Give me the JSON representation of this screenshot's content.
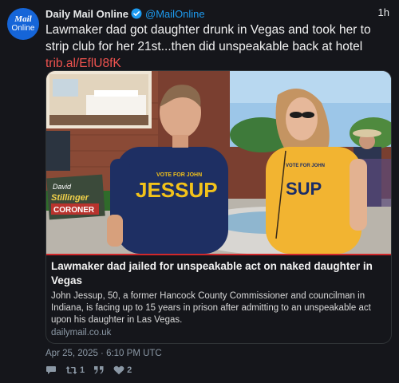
{
  "account": {
    "name": "Daily Mail Online",
    "handle": "@MailOnline",
    "time": "1h",
    "avatar_line1": "Mail",
    "avatar_line2": "Online"
  },
  "tweet": {
    "text": "Lawmaker dad got daughter drunk in Vegas and took her to strip club for her 21st...then did unspeakable back at hotel ",
    "link": "trib.al/EflU8fK"
  },
  "card": {
    "image_sign_line1": "David",
    "image_sign_line2": "Stillinger",
    "image_sign_line3": "CORONER",
    "shirt1_top": "VOTE FOR JOHN",
    "shirt1_main": "JESSUP",
    "shirt2_top": "VOTE FOR JOHN",
    "shirt2_main": "SUP",
    "title": "Lawmaker dad jailed for unspeakable act on naked daughter in Vegas",
    "description": "John Jessup, 50, a former Hancock County Commissioner and councilman in Indiana, is facing up to 15 years in prison after admitting to an unspeakable act upon his daughter in Las Vegas.",
    "domain": "dailymail.co.uk"
  },
  "timestamp": "Apr 25, 2025 · 6:10 PM UTC",
  "stats": {
    "retweets": "1",
    "likes": "2"
  },
  "colors": {
    "link": "#f0534f",
    "handle": "#1d9bf0",
    "avatar": "#1565d8",
    "card_accent": "#d0282b"
  }
}
